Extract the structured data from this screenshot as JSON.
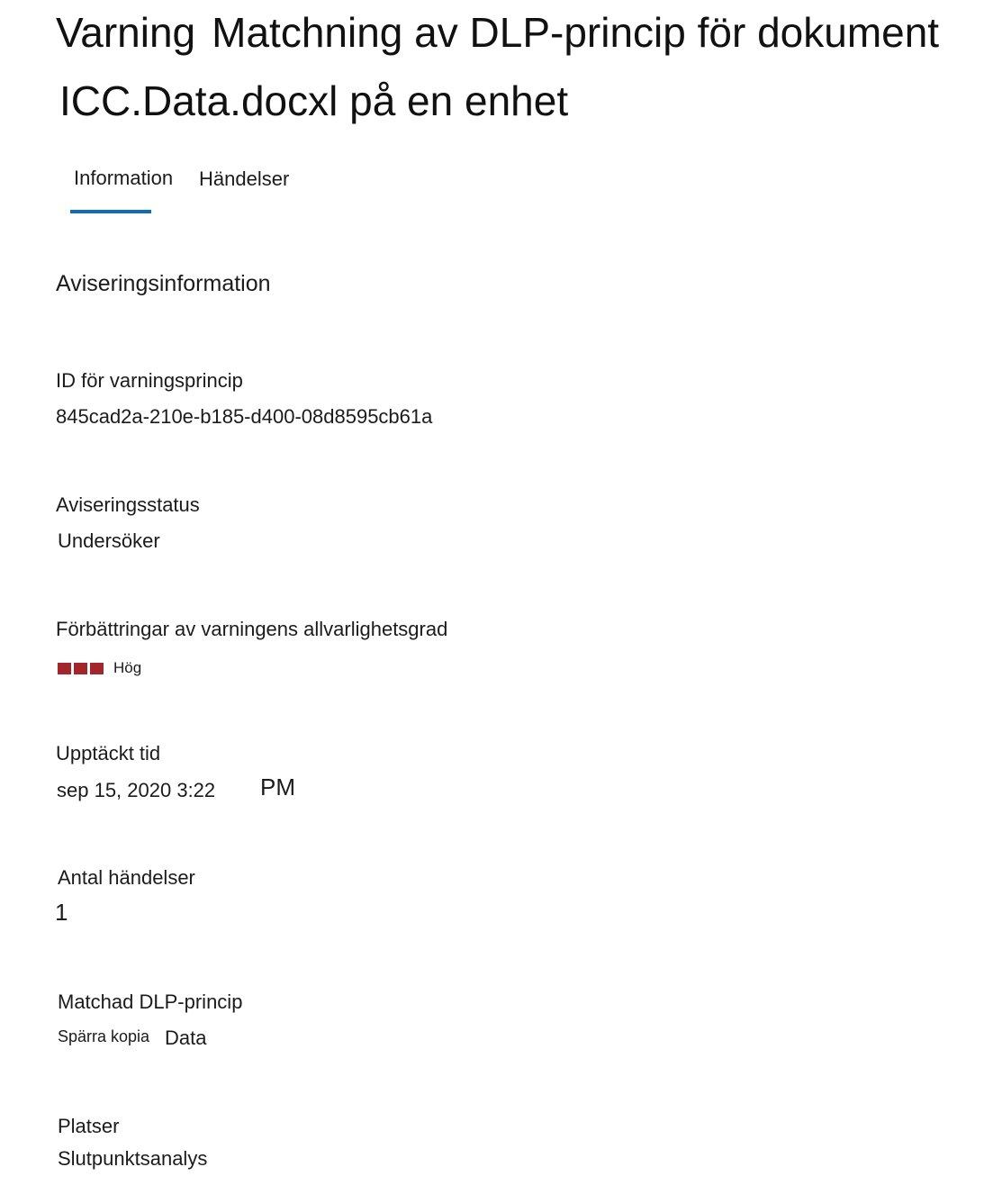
{
  "header": {
    "title_word": "Varning",
    "title_rest": "Matchning av DLP-princip för dokument",
    "title_line2": "ICC.Data.docxl på en enhet"
  },
  "tabs": [
    {
      "label": "Information",
      "selected": true
    },
    {
      "label": "Händelser",
      "selected": false
    }
  ],
  "accent_color": "#0f6cbd",
  "severity_color": "#a4262c",
  "details": {
    "section_title": "Aviseringsinformation",
    "policy_id_label": "ID för varningsprincip",
    "policy_id_value": "845cad2a-210e-b185-d400-08d8595cb61a",
    "status_label": "Aviseringsstatus",
    "status_value": "Undersöker",
    "severity_label": "Förbättringar av varningens allvarlighetsgrad",
    "severity_value": "Hög",
    "severity_level": 3,
    "detected_label": "Upptäckt tid",
    "detected_date": "sep 15, 2020 3:22",
    "detected_ampm": "PM",
    "event_count_label": "Antal händelser",
    "event_count_value": "1",
    "policy_label": "Matchad DLP-princip",
    "policy_value_part1": "Spärra kopia",
    "policy_value_part2": "Data",
    "locations_label": "Platser",
    "locations_value": "Slutpunktsanalys"
  }
}
